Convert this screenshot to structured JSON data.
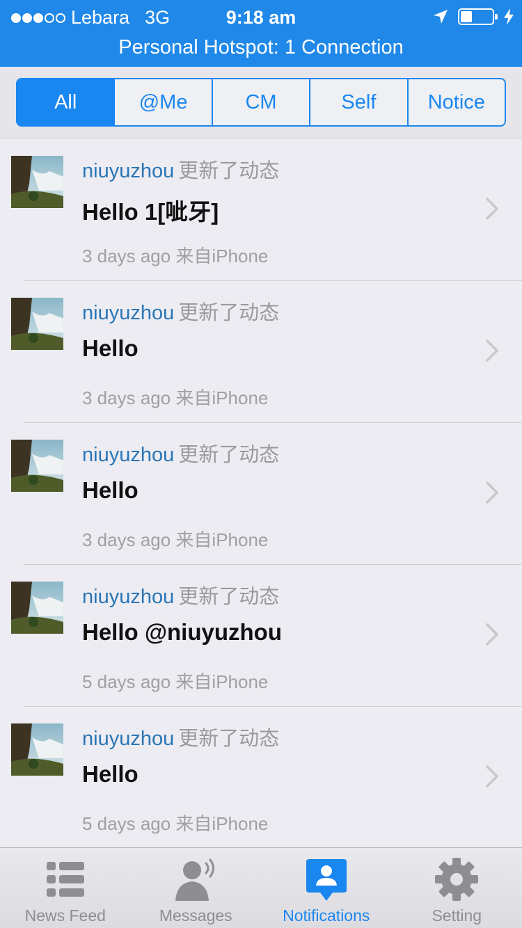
{
  "status": {
    "carrier": "Lebara",
    "network": "3G",
    "time": "9:18 am",
    "hotspot": "Personal Hotspot: 1 Connection"
  },
  "segments": [
    "All",
    "@Me",
    "CM",
    "Self",
    "Notice"
  ],
  "active_segment": "All",
  "feed": [
    {
      "user": "niuyuzhou",
      "action": "更新了动态",
      "content": "Hello 1[呲牙]",
      "meta": "3 days ago 来自iPhone"
    },
    {
      "user": "niuyuzhou",
      "action": "更新了动态",
      "content": "Hello",
      "meta": "3 days ago 来自iPhone"
    },
    {
      "user": "niuyuzhou",
      "action": "更新了动态",
      "content": "Hello",
      "meta": "3 days ago 来自iPhone"
    },
    {
      "user": "niuyuzhou",
      "action": "更新了动态",
      "content": "Hello @niuyuzhou",
      "meta": "5 days ago 来自iPhone"
    },
    {
      "user": "niuyuzhou",
      "action": "更新了动态",
      "content": "Hello",
      "meta": "5 days ago 来自iPhone"
    }
  ],
  "tabs": [
    {
      "label": "News Feed",
      "icon": "list-icon"
    },
    {
      "label": "Messages",
      "icon": "person-speaking-icon"
    },
    {
      "label": "Notifications",
      "icon": "notification-pin-icon"
    },
    {
      "label": "Setting",
      "icon": "gear-icon"
    }
  ],
  "active_tab": "Notifications",
  "colors": {
    "accent": "#1a86f0",
    "status_bar": "#1f88e8",
    "username": "#2a76b6",
    "muted": "#a0a0a4"
  }
}
